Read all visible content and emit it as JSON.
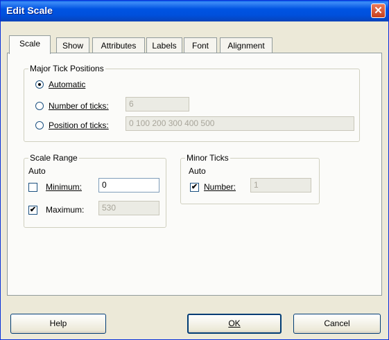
{
  "window": {
    "title": "Edit Scale",
    "close_glyph": "✕"
  },
  "tabs": [
    "Scale",
    "Show",
    "Attributes",
    "Labels",
    "Font",
    "Alignment"
  ],
  "major_ticks": {
    "title": "Major Tick Positions",
    "options": [
      {
        "label": "Automatic",
        "selected": true
      },
      {
        "label": "Number of ticks:",
        "value": "6",
        "selected": false
      },
      {
        "label": "Position of ticks:",
        "value": "0 100 200 300 400 500",
        "selected": false
      }
    ]
  },
  "scale_range": {
    "title": "Scale Range",
    "auto_label": "Auto",
    "minimum": {
      "label": "Minimum:",
      "checked": false,
      "value": "0"
    },
    "maximum": {
      "label": "Maximum:",
      "checked": true,
      "value": "530"
    }
  },
  "minor_ticks": {
    "title": "Minor Ticks",
    "auto_label": "Auto",
    "number": {
      "label": "Number:",
      "checked": true,
      "value": "1"
    }
  },
  "buttons": {
    "help": "Help",
    "ok": "OK",
    "cancel": "Cancel"
  },
  "check_glyph": "✔"
}
